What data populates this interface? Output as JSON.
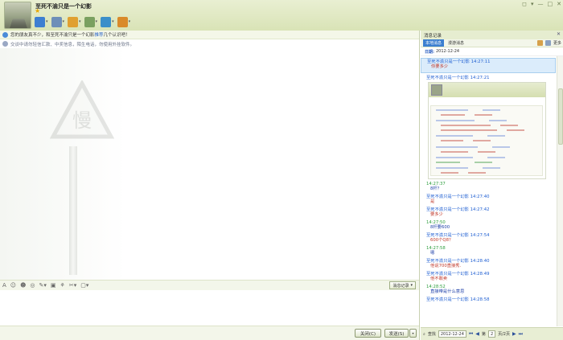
{
  "window": {
    "buddy_name": "至死不渝只是一个幻影",
    "star": "★",
    "controls": {
      "skin": "◻",
      "menu": "▾",
      "minimize": "—",
      "maximize": "□",
      "close": "✕"
    }
  },
  "toolbar": {
    "items": [
      {
        "name": "video-call",
        "color": "#3d7fd1"
      },
      {
        "name": "voice-call",
        "color": "#6d8fb8"
      },
      {
        "name": "send-file",
        "color": "#e0a030"
      },
      {
        "name": "remote-assist",
        "color": "#7aa060"
      },
      {
        "name": "screen-share",
        "color": "#3b8fc9"
      },
      {
        "name": "app-box",
        "color": "#d98a2a"
      }
    ]
  },
  "notice": {
    "line1_a": "您的朋友真不少，和至死不渝只是一个幻影",
    "line1_link": "推荐",
    "line1_b": "几个认识吧！",
    "line2": "交谈中请勿轻信汇款、中奖信息，陌生电话，勿使用外挂软件。"
  },
  "format_bar": {
    "icons": [
      "A",
      "☺",
      "☻",
      "◎",
      "✎▾",
      "▣",
      "⚘",
      "✂▾",
      "▢▾"
    ],
    "history_label": "消息记录",
    "history_caret": "▾"
  },
  "send_bar": {
    "close_label": "关闭(C)",
    "send_label": "发送(S)",
    "send_option": "▾"
  },
  "history": {
    "panel_title": "消息记录",
    "close": "✕",
    "tabs": [
      "本地消息",
      "漫游消息"
    ],
    "more_label": "更多",
    "date_label": "日期:",
    "date_value": "2012-12-24",
    "selected": {
      "sender": "至死不渝只是一个幻影 14:27:11",
      "text": "你要多少"
    },
    "pre_thumb_header": "至死不渝只是一个幻影 14:27:21",
    "messages": [
      {
        "sender": "14:27:37",
        "text": "8杆？",
        "mine": true
      },
      {
        "sender": "至死不渝只是一个幻影 14:27:40",
        "text": "是",
        "mine": false
      },
      {
        "sender": "至死不渝只是一个幻影 14:27:42",
        "text": "要多少",
        "mine": false
      },
      {
        "sender": "14:27:50",
        "text": "8杆要600",
        "mine": true
      },
      {
        "sender": "至死不渝只是一个幻影 14:27:54",
        "text": "600个Q8？",
        "mine": false
      },
      {
        "sender": "14:27:58",
        "text": "嗯",
        "mine": true
      },
      {
        "sender": "至死不渝只是一个幻影 14:28:40",
        "text": "他说700直接秀.",
        "mine": false
      },
      {
        "sender": "至死不渝只是一个幻影 14:28:49",
        "text": "他不敢卖",
        "mine": false
      },
      {
        "sender": "14:28:52",
        "text": "直接带是什么意思",
        "mine": true
      },
      {
        "sender": "至死不渝只是一个幻影 14:28:58",
        "text": "",
        "mine": false
      }
    ],
    "bottom": {
      "search_label": "查找",
      "date": "2012-12-24",
      "first": "⏮",
      "prev": "◀",
      "page_prefix": "第",
      "page": "2",
      "page_suffix": "页/2页",
      "next": "▶",
      "last": "⏭"
    }
  }
}
